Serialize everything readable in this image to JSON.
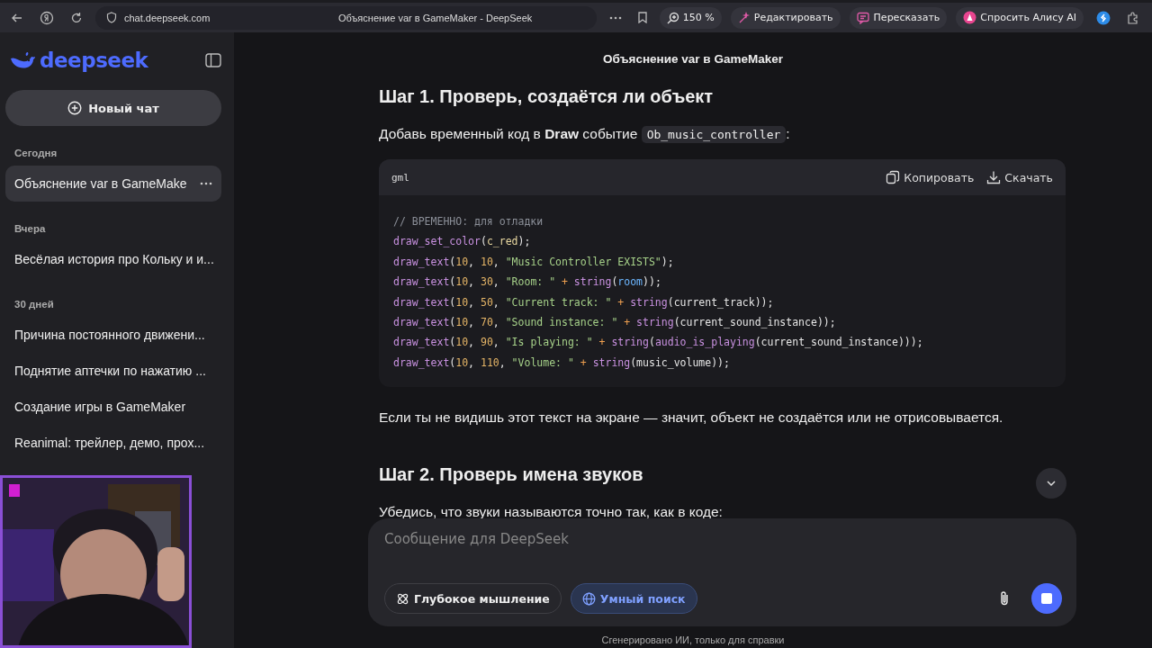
{
  "browser": {
    "url": "chat.deepseek.com",
    "tab_title": "Объяснение var в GameMaker - DeepSeek",
    "zoom": "150 %",
    "actions": [
      {
        "label": "Редактировать",
        "kind": "edit"
      },
      {
        "label": "Пересказать",
        "kind": "summary"
      },
      {
        "label": "Спросить Алису AI",
        "kind": "alice"
      }
    ]
  },
  "sidebar": {
    "logo": "deepseek",
    "new_chat": "Новый чат",
    "groups": [
      {
        "heading": "Сегодня",
        "items": [
          {
            "title": "Объяснение var в GameMake",
            "selected": true
          }
        ]
      },
      {
        "heading": "Вчера",
        "items": [
          {
            "title": "Весёлая история про Кольку и и...",
            "selected": false
          }
        ]
      },
      {
        "heading": "30 дней",
        "items": [
          {
            "title": "Причина постоянного движени...",
            "selected": false
          },
          {
            "title": "Поднятие аптечки по нажатию ...",
            "selected": false
          },
          {
            "title": "Создание игры в GameMaker",
            "selected": false
          },
          {
            "title": "Reanimal: трейлер, демо, прох...",
            "selected": false
          }
        ]
      }
    ]
  },
  "chat": {
    "title": "Объяснение var в GameMaker",
    "blocks": [
      {
        "kind": "heading",
        "text": "Шаг 1. Проверь, создаётся ли объект"
      },
      {
        "kind": "paragraph",
        "parts": [
          {
            "kind": "text",
            "text": "Добавь временный код в **Draw** событие "
          },
          {
            "kind": "code",
            "text": "Ob_music_controller"
          },
          {
            "kind": "text",
            "text": ":"
          }
        ]
      },
      {
        "kind": "code",
        "language": "gml",
        "copy": "Копировать",
        "download": "Скачать",
        "lines": [
          [
            {
              "kind": "comment",
              "text": "// ВРЕМЕННО: для отладки"
            }
          ],
          [
            {
              "kind": "fn",
              "text": "draw_set_color"
            },
            {
              "kind": "plain",
              "text": "("
            },
            {
              "kind": "const",
              "text": "c_red"
            },
            {
              "kind": "plain",
              "text": ");"
            }
          ],
          [
            {
              "kind": "fn",
              "text": "draw_text"
            },
            {
              "kind": "plain",
              "text": "("
            },
            {
              "kind": "num",
              "text": "10"
            },
            {
              "kind": "plain",
              "text": ", "
            },
            {
              "kind": "num",
              "text": "10"
            },
            {
              "kind": "plain",
              "text": ", "
            },
            {
              "kind": "str",
              "text": "\"Music Controller EXISTS\""
            },
            {
              "kind": "plain",
              "text": ");"
            }
          ],
          [
            {
              "kind": "fn",
              "text": "draw_text"
            },
            {
              "kind": "plain",
              "text": "("
            },
            {
              "kind": "num",
              "text": "10"
            },
            {
              "kind": "plain",
              "text": ", "
            },
            {
              "kind": "num",
              "text": "30"
            },
            {
              "kind": "plain",
              "text": ", "
            },
            {
              "kind": "str",
              "text": "\"Room: \""
            },
            {
              "kind": "op",
              "text": " + "
            },
            {
              "kind": "fn",
              "text": "string"
            },
            {
              "kind": "plain",
              "text": "("
            },
            {
              "kind": "builtin",
              "text": "room"
            },
            {
              "kind": "plain",
              "text": "));"
            }
          ],
          [
            {
              "kind": "fn",
              "text": "draw_text"
            },
            {
              "kind": "plain",
              "text": "("
            },
            {
              "kind": "num",
              "text": "10"
            },
            {
              "kind": "plain",
              "text": ", "
            },
            {
              "kind": "num",
              "text": "50"
            },
            {
              "kind": "plain",
              "text": ", "
            },
            {
              "kind": "str",
              "text": "\"Current track: \""
            },
            {
              "kind": "op",
              "text": " + "
            },
            {
              "kind": "fn",
              "text": "string"
            },
            {
              "kind": "plain",
              "text": "(current_track));"
            }
          ],
          [
            {
              "kind": "fn",
              "text": "draw_text"
            },
            {
              "kind": "plain",
              "text": "("
            },
            {
              "kind": "num",
              "text": "10"
            },
            {
              "kind": "plain",
              "text": ", "
            },
            {
              "kind": "num",
              "text": "70"
            },
            {
              "kind": "plain",
              "text": ", "
            },
            {
              "kind": "str",
              "text": "\"Sound instance: \""
            },
            {
              "kind": "op",
              "text": " + "
            },
            {
              "kind": "fn",
              "text": "string"
            },
            {
              "kind": "plain",
              "text": "(current_sound_instance));"
            }
          ],
          [
            {
              "kind": "fn",
              "text": "draw_text"
            },
            {
              "kind": "plain",
              "text": "("
            },
            {
              "kind": "num",
              "text": "10"
            },
            {
              "kind": "plain",
              "text": ", "
            },
            {
              "kind": "num",
              "text": "90"
            },
            {
              "kind": "plain",
              "text": ", "
            },
            {
              "kind": "str",
              "text": "\"Is playing: \""
            },
            {
              "kind": "op",
              "text": " + "
            },
            {
              "kind": "fn",
              "text": "string"
            },
            {
              "kind": "plain",
              "text": "("
            },
            {
              "kind": "fn",
              "text": "audio_is_playing"
            },
            {
              "kind": "plain",
              "text": "(current_sound_instance)));"
            }
          ],
          [
            {
              "kind": "fn",
              "text": "draw_text"
            },
            {
              "kind": "plain",
              "text": "("
            },
            {
              "kind": "num",
              "text": "10"
            },
            {
              "kind": "plain",
              "text": ", "
            },
            {
              "kind": "num",
              "text": "110"
            },
            {
              "kind": "plain",
              "text": ", "
            },
            {
              "kind": "str",
              "text": "\"Volume: \""
            },
            {
              "kind": "op",
              "text": " + "
            },
            {
              "kind": "fn",
              "text": "string"
            },
            {
              "kind": "plain",
              "text": "(music_volume));"
            }
          ]
        ]
      },
      {
        "kind": "paragraph",
        "parts": [
          {
            "kind": "text",
            "text": "Если ты не видишь этот текст на экране — значит, объект не создаётся или не отрисовывается."
          }
        ]
      },
      {
        "kind": "heading",
        "text": "Шаг 2. Проверь имена звуков"
      },
      {
        "kind": "paragraph",
        "parts": [
          {
            "kind": "text",
            "text": "Убедись, что звуки называются точно так, как в коде:"
          }
        ]
      }
    ]
  },
  "composer": {
    "placeholder": "Сообщение для DeepSeek",
    "toggles": [
      {
        "label": "Глубокое мышление",
        "selected": false,
        "kind": "think"
      },
      {
        "label": "Умный поиск",
        "selected": true,
        "kind": "search"
      }
    ]
  },
  "footer": "Сгенерировано ИИ, только для справки"
}
